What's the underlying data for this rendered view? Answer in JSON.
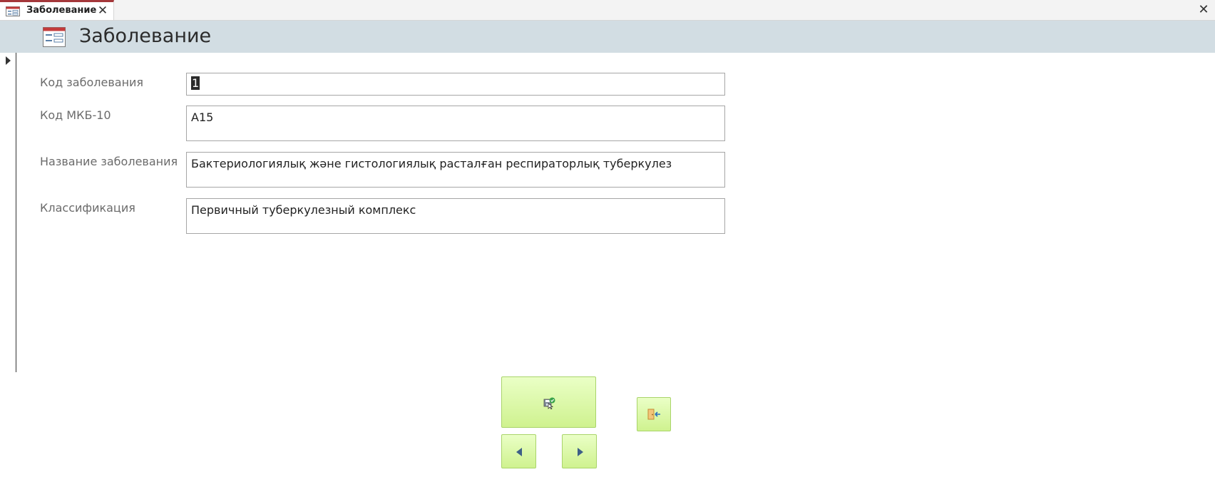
{
  "tab": {
    "label": "Заболевание"
  },
  "header": {
    "title": "Заболевание"
  },
  "fields": [
    {
      "label": "Код заболевания",
      "value": "1"
    },
    {
      "label": "Код МКБ-10",
      "value": "А15"
    },
    {
      "label": "Название заболевания",
      "value": "Бактериологиялық және гистологиялық расталған респираторлық туберкулез"
    },
    {
      "label": "Классификация",
      "value": "Первичный туберкулезный комплекс"
    }
  ],
  "icons": {
    "tab": "form-icon",
    "header": "form-icon",
    "save": "save-record-icon",
    "exit": "exit-door-icon",
    "prev": "triangle-left-icon",
    "next": "triangle-right-icon",
    "close": "close-icon"
  },
  "colors": {
    "tab_accent": "#a4373a",
    "header_bg": "#d2dde3",
    "button_bg": "#cff28f"
  }
}
